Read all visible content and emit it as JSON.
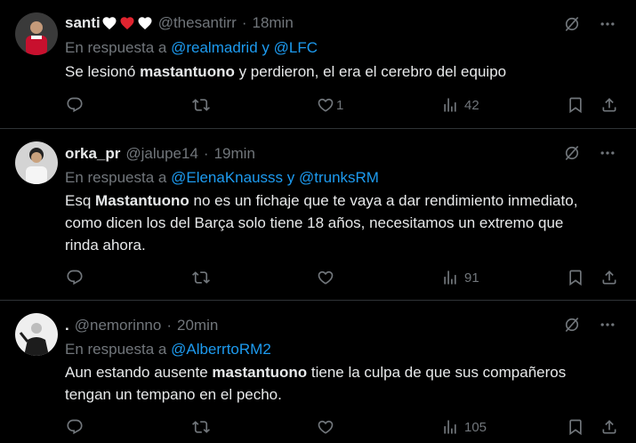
{
  "tweets": [
    {
      "name": "santi",
      "handle": "@thesantirr",
      "sep": "·",
      "time": "18min",
      "reply_prefix": "En respuesta a",
      "reply_mentions": "@realmadrid y @LFC",
      "body_pre": "Se lesionó ",
      "body_bold": "mastantuono",
      "body_post": " y perdieron, el era el cerebro del equipo",
      "views": "42",
      "likes": "1",
      "replies": "",
      "reposts": "",
      "avatar_colors": [
        "#c8102e",
        "#5a1010",
        "#ddd"
      ]
    },
    {
      "name": "orka_pr",
      "handle": "@jalupe14",
      "sep": "·",
      "time": "19min",
      "reply_prefix": "En respuesta a",
      "reply_mentions": "@ElenaKnausss y @trunksRM",
      "body_pre": "Esq ",
      "body_bold": "Mastantuono",
      "body_post": " no es un fichaje que te vaya a dar rendimiento inmediato, como dicen los del Barça solo tiene 18 años, necesitamos un extremo que rinda ahora.",
      "views": "91",
      "likes": "",
      "replies": "",
      "reposts": "",
      "avatar_colors": [
        "#d9d9d9",
        "#7a6a55",
        "#eaeaea"
      ]
    },
    {
      "name": ".",
      "handle": "@nemorinno",
      "sep": "·",
      "time": "20min",
      "reply_prefix": "En respuesta a",
      "reply_mentions": "@AlberrtoRM2",
      "body_pre": "Aun estando ausente ",
      "body_bold": "mastantuono",
      "body_post": " tiene la culpa de que sus compañeros tengan un tempano en el pecho.",
      "views": "105",
      "likes": "",
      "replies": "",
      "reposts": "",
      "avatar_colors": [
        "#f0f0f0",
        "#222",
        "#888"
      ]
    }
  ],
  "colors": {
    "background": "#000000",
    "text": "#e7e9ea",
    "muted": "#71767b",
    "link": "#1d9bf0",
    "heart_red": "#f91880",
    "divider": "#2f3336"
  },
  "icons": [
    "grok-icon",
    "more-icon",
    "reply-icon",
    "repost-icon",
    "like-icon",
    "views-icon",
    "bookmark-icon",
    "share-icon"
  ]
}
